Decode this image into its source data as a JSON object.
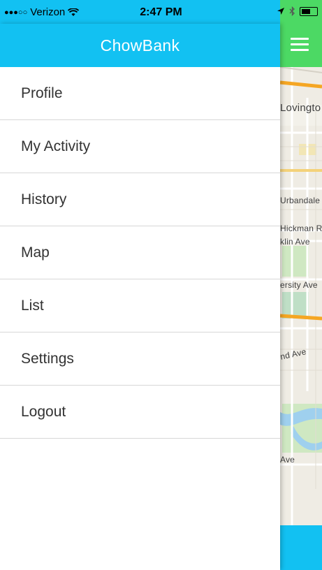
{
  "status_bar": {
    "signal": "●●●○○",
    "carrier": "Verizon",
    "time": "2:47 PM",
    "location_icon": "location-arrow-icon",
    "bluetooth_icon": "bluetooth-icon",
    "wifi_icon": "wifi-icon",
    "battery_icon": "battery-icon"
  },
  "drawer": {
    "title": "ChowBank",
    "items": [
      {
        "label": "Profile"
      },
      {
        "label": "My Activity"
      },
      {
        "label": "History"
      },
      {
        "label": "Map"
      },
      {
        "label": "List"
      },
      {
        "label": "Settings"
      },
      {
        "label": "Logout"
      }
    ]
  },
  "map": {
    "labels": [
      "Lovingto",
      "Urbandale",
      "Hickman R",
      "klin Ave",
      "ersity Ave",
      "nd Ave",
      "Ave"
    ]
  },
  "colors": {
    "header": "#12c1f2",
    "menu_button_bg": "#4cd964",
    "text": "#333333"
  }
}
